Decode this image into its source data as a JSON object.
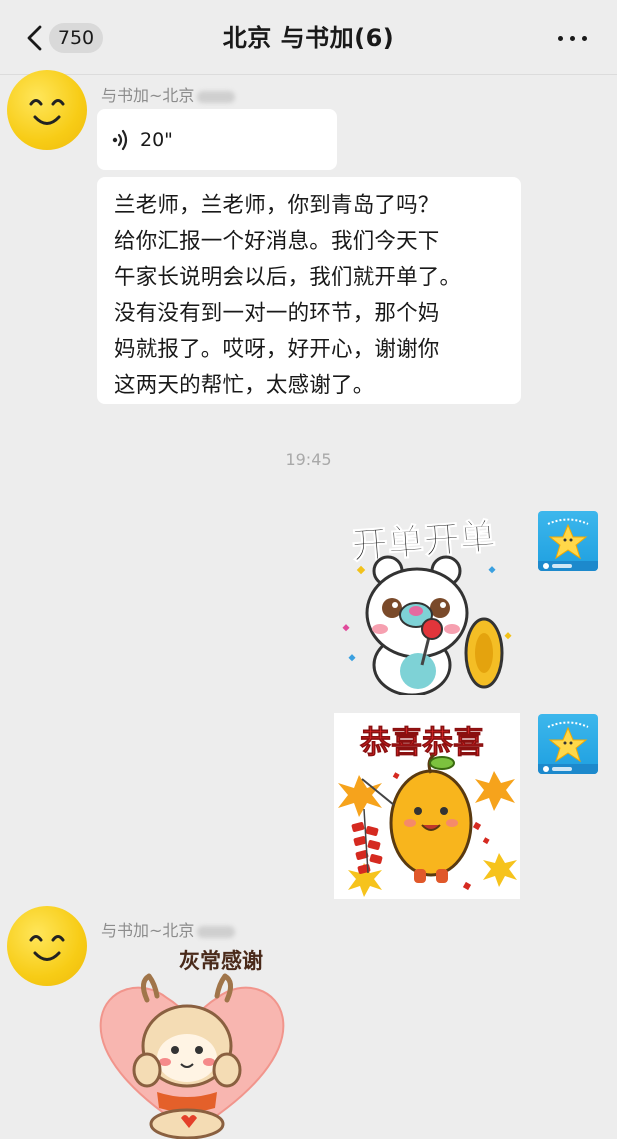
{
  "header": {
    "back_badge": "750",
    "title": "北京 与书加(6)"
  },
  "messages": [
    {
      "sender": "与书加~北京",
      "voice_duration": "20\"",
      "text_lines": [
        "兰老师，兰老师，你到青岛了吗？",
        "给你汇报一个好消息。我们今天下",
        "午家长说明会以后，我们就开单了。",
        "没有没有到一对一的环节，那个妈",
        "妈就报了。哎呀，好开心，谢谢你",
        "这两天的帮忙，太感谢了。"
      ]
    },
    {
      "timestamp": "19:45"
    },
    {
      "sticker1_text": "开单开单",
      "sticker2_text": "恭喜恭喜"
    },
    {
      "sender": "与书加~北京",
      "sticker_text": "灰常感谢"
    }
  ],
  "colors": {
    "background": "#ededed",
    "bubble": "#ffffff",
    "avatar_yellow": "#f7cc16",
    "my_avatar_blue": "#1e9fe0",
    "sticker_red": "#e0282a",
    "sticker_orange": "#f6a31c"
  }
}
